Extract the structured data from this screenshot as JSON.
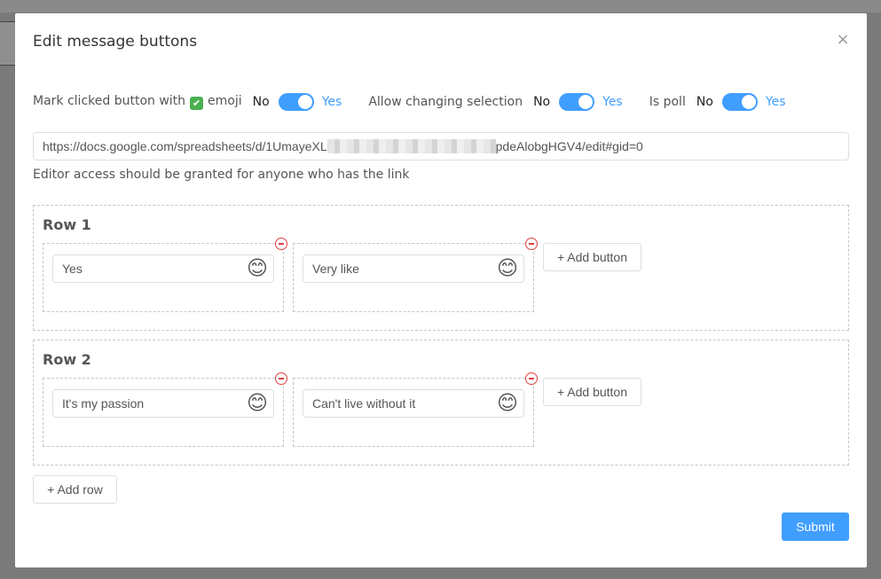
{
  "modal": {
    "title": "Edit message buttons",
    "close_icon": "×"
  },
  "toggles": [
    {
      "label_before": "Mark clicked button with",
      "emoji": "✅",
      "label_after": "emoji",
      "no": "No",
      "yes": "Yes",
      "on": true
    },
    {
      "label": "Allow changing selection",
      "no": "No",
      "yes": "Yes",
      "on": true
    },
    {
      "label": "Is poll",
      "no": "No",
      "yes": "Yes",
      "on": true
    }
  ],
  "sheet": {
    "url_start": "https://docs.google.com/spreadsheets/d/1UmayeXL",
    "url_end": "pdeAlobgHGV4/edit#gid=0",
    "hint": "Editor access should be granted for anyone who has the link"
  },
  "rows": [
    {
      "title": "Row 1",
      "buttons": [
        "Yes",
        "Very like"
      ],
      "add_button": "+ Add button"
    },
    {
      "title": "Row 2",
      "buttons": [
        "It's my passion",
        "Can't live without it"
      ],
      "add_button": "+ Add button"
    }
  ],
  "emoji_icon": "😊",
  "add_row": "+ Add row",
  "submit": "Submit",
  "colors": {
    "accent": "#409eff",
    "danger": "#e04040"
  }
}
